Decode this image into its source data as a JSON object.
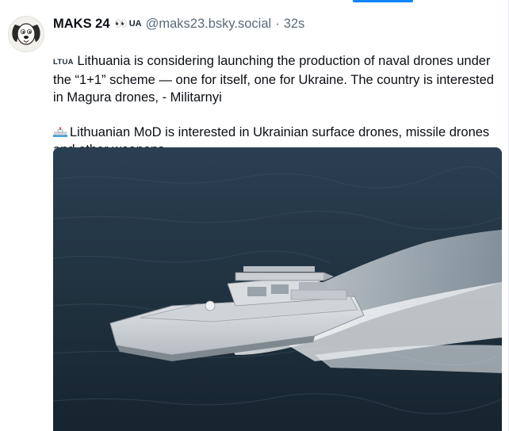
{
  "post": {
    "author": {
      "display_name": "MAKS 24",
      "eyes_emoji": "👀",
      "country_badge": "UA",
      "handle": "@maks23.bsky.social",
      "separator": "·",
      "timestamp": "32s",
      "avatar_icon": "cartoon-dog-avatar"
    },
    "paragraphs": [
      {
        "flag_tag": "LTUA",
        "text": "Lithuania is considering launching the production of naval drones under the “1+1” scheme — one for itself, one for Ukraine. The country is interested in Magura drones, - Militarnyi"
      },
      {
        "emoji_icon": "ship-icon",
        "text": "Lithuanian MoD is interested in Ukrainian surface drones, missile drones and other weapons."
      }
    ],
    "media": {
      "type": "image",
      "subject": "naval-drone-boat-image"
    }
  },
  "colors": {
    "accent": "#1083fe",
    "text": "#0b0f14",
    "muted": "#5b6b7c",
    "sea": "#22364a"
  }
}
